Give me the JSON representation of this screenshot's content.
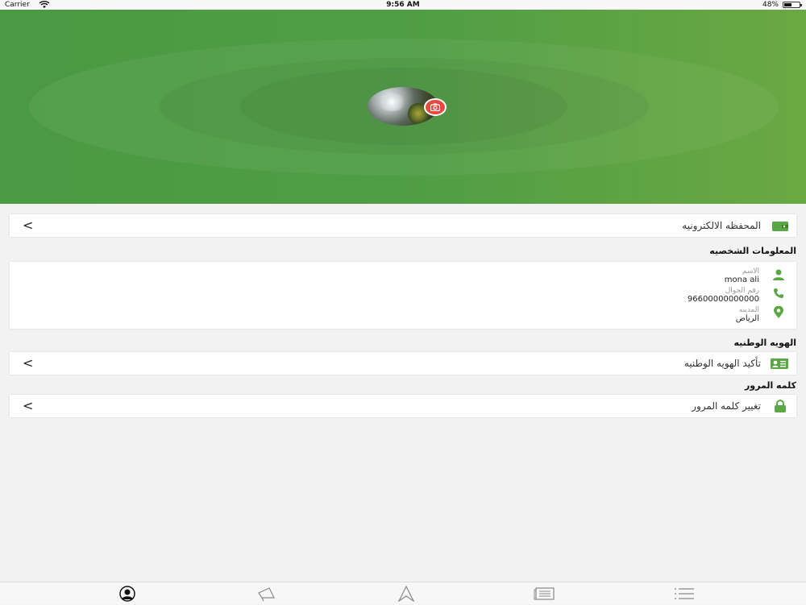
{
  "status_bar": {
    "carrier": "Carrier",
    "time": "9:56 AM",
    "battery": "48%",
    "battery_level": 0.48
  },
  "colors": {
    "brand_green": "#4f9d44",
    "accent_red": "#e64940",
    "icon_green": "#5aa845"
  },
  "profile": {
    "avatar_icon": "profile-photo",
    "camera_icon": "camera-icon"
  },
  "wallet": {
    "label": "المحفظه الالكترونيه",
    "chevron": "<"
  },
  "personal_info": {
    "section_title": "المعلومات الشخصيه",
    "name_caption": "الاسم",
    "name_value": "mona ali",
    "phone_caption": "رقم الجوال",
    "phone_value": "96600000000000",
    "city_caption": "المدينه",
    "city_value": "الرياض"
  },
  "national_id": {
    "section_title": "الهويه الوطنيه",
    "label": "تأكيد الهويه الوطنيه",
    "chevron": "<"
  },
  "password": {
    "section_title": "كلمه المرور",
    "label": "تغيير كلمه المرور",
    "chevron": "<"
  },
  "tab_bar": {
    "tabs": [
      "profile-icon",
      "megaphone-icon",
      "location-icon",
      "news-icon",
      "menu-list-icon"
    ],
    "active": "profile-icon"
  }
}
